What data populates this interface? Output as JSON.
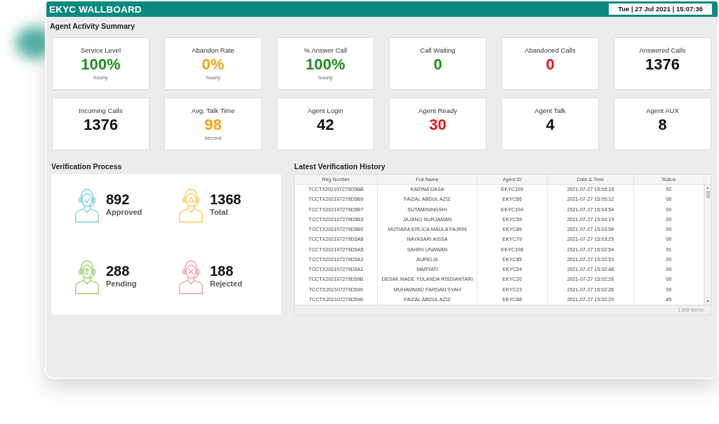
{
  "window": {
    "title": "EKYC WALLBOARD",
    "datetime": "Tue | 27 Jul 2021 | 15:07:36"
  },
  "agent_activity_summary": {
    "title": "Agent Activity Summary",
    "cards": [
      {
        "label": "Service Level",
        "value": "100%",
        "color": "#1e8c22",
        "note": "hourly"
      },
      {
        "label": "Abandon Rate",
        "value": "0%",
        "color": "#f5a30f",
        "note": "hourly"
      },
      {
        "label": "% Answer Call",
        "value": "100%",
        "color": "#1e8c22",
        "note": "hourly"
      },
      {
        "label": "Call Waiting",
        "value": "0",
        "color": "#1e8c22"
      },
      {
        "label": "Abandoned Calls",
        "value": "0",
        "color": "#e8141c"
      },
      {
        "label": "Answered Calls",
        "value": "1376",
        "color": "#111111"
      },
      {
        "label": "Incoming Calls",
        "value": "1376",
        "color": "#111111"
      },
      {
        "label": "Avg. Talk Time",
        "value": "98",
        "color": "#f5a30f",
        "note": "second"
      },
      {
        "label": "Agent Login",
        "value": "42",
        "color": "#111111"
      },
      {
        "label": "Agent Ready",
        "value": "30",
        "color": "#e8141c"
      },
      {
        "label": "Agent Talk",
        "value": "4",
        "color": "#111111"
      },
      {
        "label": "Agent AUX",
        "value": "8",
        "color": "#111111"
      }
    ]
  },
  "verification_process": {
    "title": "Verification Process",
    "stats": [
      {
        "kind": "check",
        "color": "#7fd3d8",
        "value": "892",
        "label": "Approved"
      },
      {
        "kind": "triangle",
        "color": "#f2cf5b",
        "value": "1368",
        "label": "Total"
      },
      {
        "kind": "swirl",
        "color": "#9ed36a",
        "value": "288",
        "label": "Pending"
      },
      {
        "kind": "cross",
        "color": "#f4a3a8",
        "value": "188",
        "label": "Rejected"
      }
    ]
  },
  "latest_verification_history": {
    "title": "Latest Verification History",
    "columns": [
      "Reg.Number",
      "Full Name",
      "Agent ID",
      "Date & Time",
      "Status"
    ],
    "rows": [
      [
        "TCCTX202107279D5BB",
        "KARINA DASA",
        "EKYC109",
        "2021-07-27 15:05:15",
        "92"
      ],
      [
        "TCCTX202107279D5B9",
        "FAIZAL ABDUL AZIZ",
        "EKYC66",
        "2021-07-27 15:05:12",
        "00"
      ],
      [
        "TCCTX202107279D5B7",
        "SUTAMININGSIH",
        "EKYC104",
        "2021-07-27 15:04:54",
        "00"
      ],
      [
        "TCCTX202107279D5B3",
        "JAJANG NURJAMAN",
        "EKYC59",
        "2021-07-27 15:04:19",
        "00"
      ],
      [
        "TCCTX202107279D5B0",
        "MUTIARA ERLICA MAULA FAJRIN",
        "EKYC89",
        "2021-07-27 15:03:58",
        "00"
      ],
      [
        "TCCTX202107279D5A8",
        "NAYASARI AISSA",
        "EKYC79",
        "2021-07-27 15:03:25",
        "00"
      ],
      [
        "TCCTX202107279D5A5",
        "SAHRII UNAWAN",
        "EKYC108",
        "2021-07-27 15:02:54",
        "91"
      ],
      [
        "TCCTX202107279D5A3",
        "AURELIA",
        "EKYC85",
        "2021-07-27 15:02:53",
        "00"
      ],
      [
        "TCCTX202107279D5A1",
        "MARYATI",
        "EKYC24",
        "2021-07-27 15:02:48",
        "00"
      ],
      [
        "TCCTX202107279D59B",
        "DESAK MADE YULANDA RISDIANTARI",
        "EKYC20",
        "2021-07-27 15:02:28",
        "00"
      ],
      [
        "TCCTX202107279D599",
        "MUHAMMAD FARDAN SYAH",
        "EKYC23",
        "2021-07-27 15:02:26",
        "00"
      ],
      [
        "TCCTX202107279D596",
        "FAIZAL ABDUL AZIZ",
        "EKYC68",
        "2021-07-27 15:02:20",
        "85"
      ]
    ],
    "footer": "1368 items"
  }
}
